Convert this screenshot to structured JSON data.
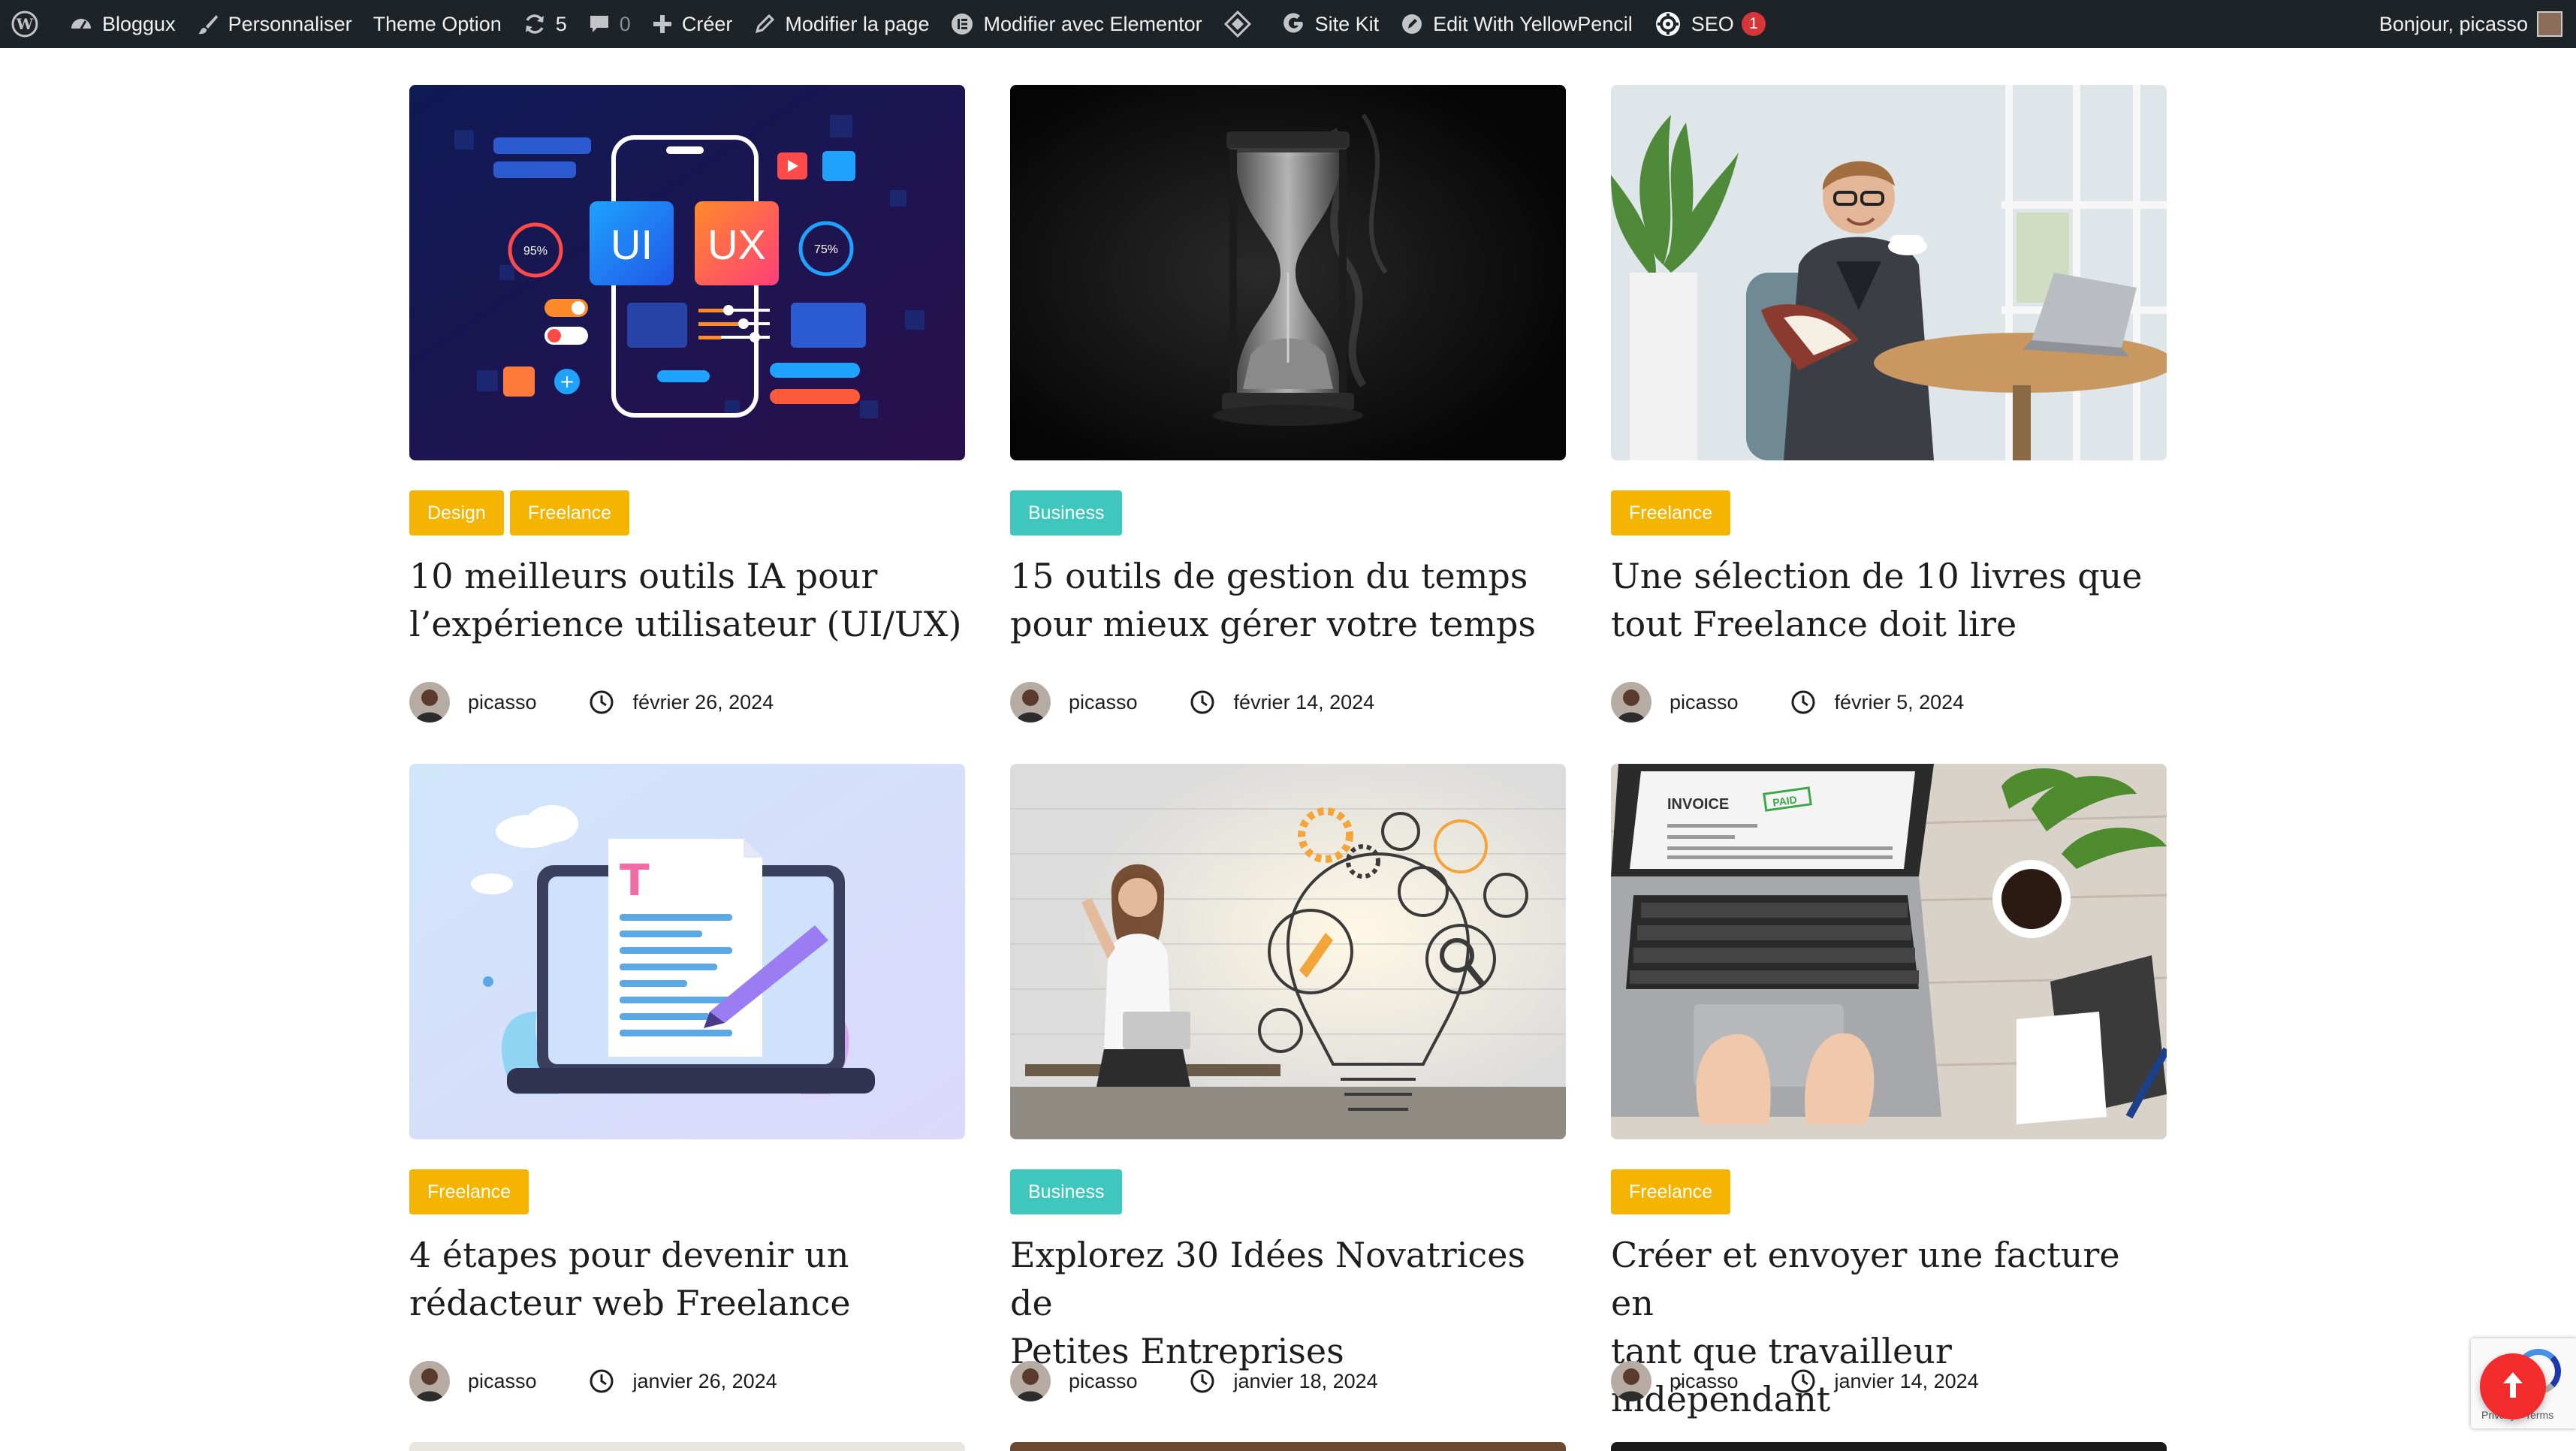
{
  "adminbar": {
    "site_name": "Bloggux",
    "customize": "Personnaliser",
    "theme_option": "Theme Option",
    "updates_count": "5",
    "comments_count": "0",
    "new": "Créer",
    "edit_page": "Modifier la page",
    "edit_elementor": "Modifier avec Elementor",
    "site_kit": "Site Kit",
    "yellowpencil": "Edit With YellowPencil",
    "seo": "SEO",
    "seo_badge": "1",
    "greeting": "Bonjour, picasso"
  },
  "posts": [
    {
      "image": "ui-ux-illustration",
      "image_labels": {
        "ui": "UI",
        "ux": "UX",
        "gauge_left": "95%",
        "gauge_right": "75%"
      },
      "categories": [
        {
          "label": "Design",
          "color": "#f5b400"
        },
        {
          "label": "Freelance",
          "color": "#f5b400"
        }
      ],
      "title_line1": "10 meilleurs outils IA pour",
      "title_line2": "l’expérience utilisateur (UI/UX)",
      "author": "picasso",
      "date": "février 26, 2024"
    },
    {
      "image": "hourglass-photo",
      "categories": [
        {
          "label": "Business",
          "color": "#3fc7bd"
        }
      ],
      "title_line1": "15 outils de gestion du temps",
      "title_line2": "pour mieux gérer votre temps",
      "author": "picasso",
      "date": "février 14, 2024"
    },
    {
      "image": "man-reading-book-photo",
      "categories": [
        {
          "label": "Freelance",
          "color": "#f5b400"
        }
      ],
      "title_line1": "Une sélection de 10 livres que",
      "title_line2": "tout Freelance doit lire",
      "author": "picasso",
      "date": "février 5, 2024"
    },
    {
      "image": "laptop-document-illustration",
      "categories": [
        {
          "label": "Freelance",
          "color": "#f5b400"
        }
      ],
      "title_line1": "4 étapes pour devenir un",
      "title_line2": "rédacteur web Freelance",
      "author": "picasso",
      "date": "janvier 26, 2024"
    },
    {
      "image": "woman-ideas-lightbulb-photo",
      "categories": [
        {
          "label": "Business",
          "color": "#3fc7bd"
        }
      ],
      "title_line1": "Explorez 30 Idées Novatrices de",
      "title_line2": "Petites Entreprises",
      "author": "picasso",
      "date": "janvier 18, 2024"
    },
    {
      "image": "invoice-laptop-desk-photo",
      "image_labels": {
        "invoice": "INVOICE",
        "paid": "PAID"
      },
      "categories": [
        {
          "label": "Freelance",
          "color": "#f5b400"
        }
      ],
      "title_line1": "Créer et envoyer une facture en",
      "title_line2": "tant que travailleur indépendant",
      "author": "picasso",
      "date": "janvier 14, 2024"
    }
  ],
  "recaptcha": {
    "links": "Privacy - Terms"
  },
  "colors": {
    "adminbar_bg": "#1d2327",
    "category_yellow": "#f5b400",
    "category_teal": "#3fc7bd",
    "back_to_top": "#f22c2c"
  }
}
